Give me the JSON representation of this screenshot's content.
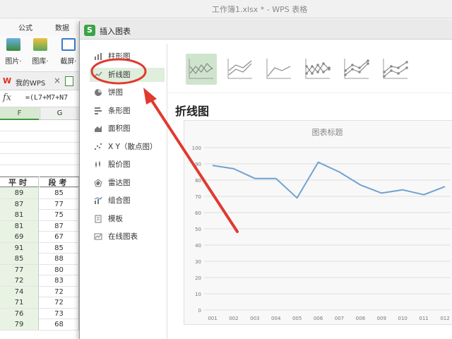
{
  "app": {
    "title": "工作簿1.xlsx * - WPS 表格"
  },
  "ribbon_tabs": [
    "公式",
    "数据"
  ],
  "ribbon_buttons": [
    {
      "label": "图片·",
      "icon": "picture-icon"
    },
    {
      "label": "图库·",
      "icon": "gallery-icon"
    },
    {
      "label": "截屏·",
      "icon": "screenshot-icon"
    }
  ],
  "doc_tabs": {
    "home_label": "我的WPS",
    "close": "×"
  },
  "formula_bar": {
    "fx": "fx",
    "formula": "=(L7+M7+N7"
  },
  "sheet": {
    "columns": [
      "F",
      "G"
    ],
    "header": [
      "平时",
      "段考"
    ],
    "rows": [
      [
        "89",
        "85"
      ],
      [
        "87",
        "77"
      ],
      [
        "81",
        "75"
      ],
      [
        "81",
        "87"
      ],
      [
        "69",
        "67"
      ],
      [
        "91",
        "85"
      ],
      [
        "85",
        "88"
      ],
      [
        "77",
        "80"
      ],
      [
        "72",
        "83"
      ],
      [
        "74",
        "72"
      ],
      [
        "71",
        "72"
      ],
      [
        "76",
        "73"
      ],
      [
        "79",
        "68"
      ]
    ]
  },
  "dialog": {
    "logo": "S",
    "title": "插入图表",
    "categories": [
      {
        "label": "柱形图",
        "icon": "column-chart-icon"
      },
      {
        "label": "折线图",
        "icon": "line-chart-icon"
      },
      {
        "label": "饼图",
        "icon": "pie-chart-icon"
      },
      {
        "label": "条形图",
        "icon": "bar-chart-icon"
      },
      {
        "label": "面积图",
        "icon": "area-chart-icon"
      },
      {
        "label": "X Y（散点图）",
        "icon": "scatter-chart-icon"
      },
      {
        "label": "股价图",
        "icon": "stock-chart-icon"
      },
      {
        "label": "雷达图",
        "icon": "radar-chart-icon"
      },
      {
        "label": "组合图",
        "icon": "combo-chart-icon"
      },
      {
        "label": "模板",
        "icon": "template-icon"
      },
      {
        "label": "在线图表",
        "icon": "online-chart-icon"
      }
    ],
    "active_category": 1,
    "active_subtype": 0,
    "chart_type_title": "折线图"
  },
  "chart_data": {
    "type": "line",
    "title": "图表标题",
    "categories": [
      "001",
      "002",
      "003",
      "004",
      "005",
      "006",
      "007",
      "008",
      "009",
      "010",
      "011",
      "012"
    ],
    "values": [
      89,
      87,
      81,
      81,
      69,
      91,
      85,
      77,
      72,
      74,
      71,
      76
    ],
    "ylim": [
      0,
      100
    ],
    "yticks": [
      0,
      10,
      20,
      30,
      40,
      50,
      60,
      70,
      80,
      90,
      100
    ],
    "grid": true,
    "line_color": "#6fa3d2"
  },
  "colors": {
    "accent": "#3aa447",
    "active_bg": "#dfeedd",
    "annotation": "#e03a2f"
  }
}
